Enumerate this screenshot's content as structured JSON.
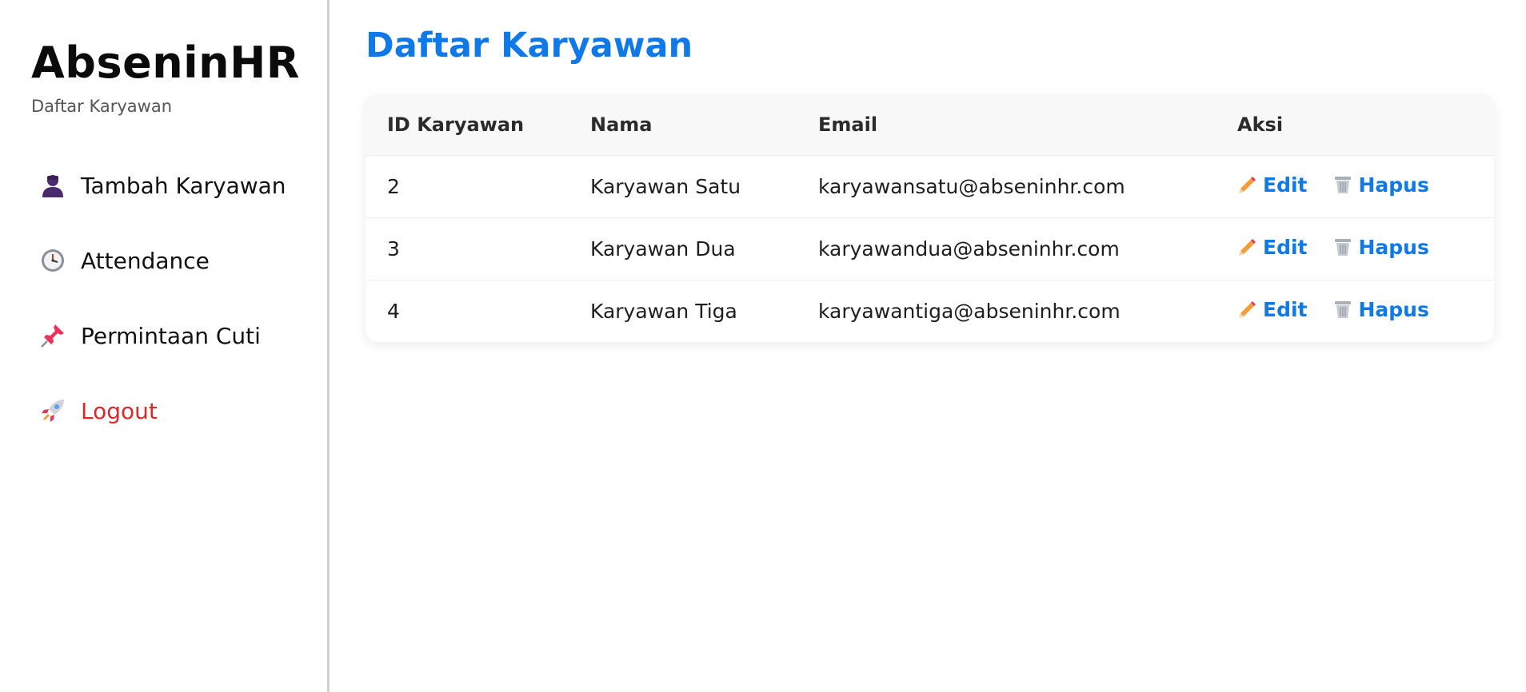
{
  "sidebar": {
    "brand_title": "AbseninHR",
    "brand_subtitle": "Daftar Karyawan",
    "items": [
      {
        "label": "Tambah Karyawan",
        "icon": "person-icon"
      },
      {
        "label": "Attendance",
        "icon": "clock-icon"
      },
      {
        "label": "Permintaan Cuti",
        "icon": "pushpin-icon"
      },
      {
        "label": "Logout",
        "icon": "rocket-icon"
      }
    ]
  },
  "main": {
    "title": "Daftar Karyawan",
    "table": {
      "headers": [
        "ID Karyawan",
        "Nama",
        "Email",
        "Aksi"
      ],
      "rows": [
        {
          "id": "2",
          "nama": "Karyawan Satu",
          "email": "karyawansatu@abseninhr.com"
        },
        {
          "id": "3",
          "nama": "Karyawan Dua",
          "email": "karyawandua@abseninhr.com"
        },
        {
          "id": "4",
          "nama": "Karyawan Tiga",
          "email": "karyawantiga@abseninhr.com"
        }
      ],
      "actions": {
        "edit_label": "Edit",
        "edit_icon": "pencil-icon",
        "delete_label": "Hapus",
        "delete_icon": "trash-icon"
      }
    }
  },
  "colors": {
    "accent": "#1178e8",
    "logout": "#d62b2b",
    "text": "#111111"
  }
}
